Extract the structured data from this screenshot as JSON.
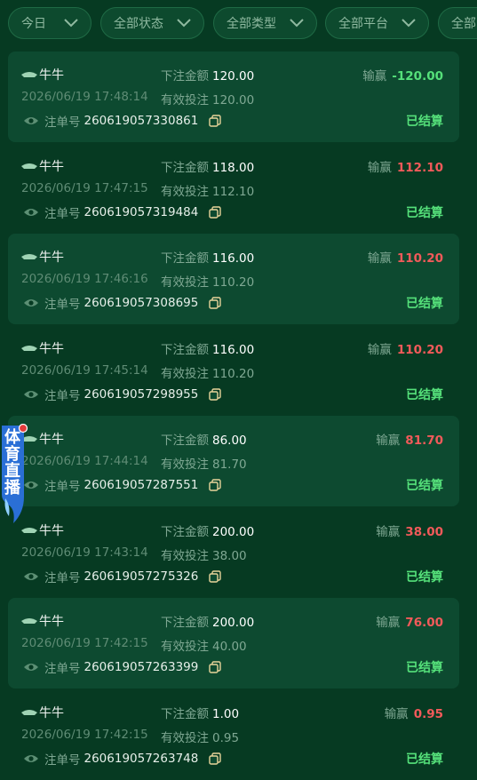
{
  "filters": [
    {
      "label": "今日"
    },
    {
      "label": "全部状态"
    },
    {
      "label": "全部类型"
    },
    {
      "label": "全部平台"
    },
    {
      "label": "全部"
    }
  ],
  "labels": {
    "bet_amount": "下注金额",
    "valid_bet": "有效投注",
    "win_loss": "输赢",
    "order_no": "注单号"
  },
  "records": [
    {
      "game": "牛牛",
      "bet": "120.00",
      "time": "2026/06/19 17:48:14",
      "valid": "120.00",
      "win": "-120.00",
      "win_color": "green",
      "order": "260619057330861",
      "status": "已结算"
    },
    {
      "game": "牛牛",
      "bet": "118.00",
      "time": "2026/06/19 17:47:15",
      "valid": "112.10",
      "win": "112.10",
      "win_color": "red",
      "order": "260619057319484",
      "status": "已结算"
    },
    {
      "game": "牛牛",
      "bet": "116.00",
      "time": "2026/06/19 17:46:16",
      "valid": "110.20",
      "win": "110.20",
      "win_color": "red",
      "order": "260619057308695",
      "status": "已结算"
    },
    {
      "game": "牛牛",
      "bet": "116.00",
      "time": "2026/06/19 17:45:14",
      "valid": "110.20",
      "win": "110.20",
      "win_color": "red",
      "order": "260619057298955",
      "status": "已结算"
    },
    {
      "game": "牛牛",
      "bet": "86.00",
      "time": "2026/06/19 17:44:14",
      "valid": "81.70",
      "win": "81.70",
      "win_color": "red",
      "order": "260619057287551",
      "status": "已结算"
    },
    {
      "game": "牛牛",
      "bet": "200.00",
      "time": "2026/06/19 17:43:14",
      "valid": "38.00",
      "win": "38.00",
      "win_color": "red",
      "order": "260619057275326",
      "status": "已结算"
    },
    {
      "game": "牛牛",
      "bet": "200.00",
      "time": "2026/06/19 17:42:15",
      "valid": "40.00",
      "win": "76.00",
      "win_color": "red",
      "order": "260619057263399",
      "status": "已结算"
    },
    {
      "game": "牛牛",
      "bet": "1.00",
      "time": "2026/06/19 17:42:15",
      "valid": "0.95",
      "win": "0.95",
      "win_color": "red",
      "order": "260619057263748",
      "status": "已结算"
    }
  ],
  "floating_badge": {
    "label": "体育直播"
  },
  "colors": {
    "bg": "#063a22",
    "card": "#0d4a30",
    "win": "#f25a5a",
    "loss": "#55e07a"
  }
}
